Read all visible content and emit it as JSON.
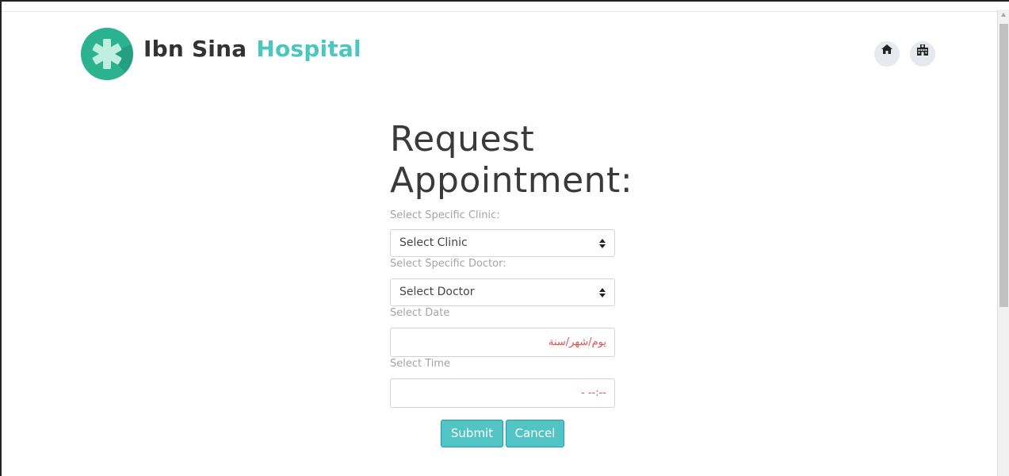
{
  "header": {
    "brand_primary": "Ibn Sina",
    "brand_secondary": "Hospital",
    "icons": {
      "logo": "star-of-life-icon",
      "home": "home-icon",
      "hospital": "hospital-icon"
    }
  },
  "form": {
    "title_line1": "Request",
    "title_line2": "Appointment:",
    "clinic_label": "Select Specific Clinic:",
    "clinic_value": "Select Clinic",
    "doctor_label": "Select Specific Doctor:",
    "doctor_value": "Select Doctor",
    "date_label": "Select Date",
    "date_placeholder": "يوم/شهر/سنة",
    "time_label": "Select Time",
    "time_placeholder": "--:-- -",
    "submit_label": "Submit",
    "cancel_label": "Cancel"
  },
  "colors": {
    "brand_accent": "#4cc7c0",
    "logo_green": "#2bb28f",
    "button_bg": "#52c4c4",
    "placeholder_red": "#d9534f"
  }
}
